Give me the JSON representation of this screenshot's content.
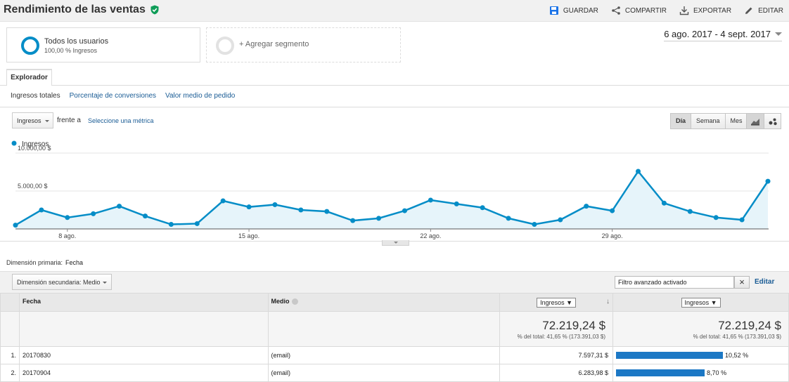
{
  "header": {
    "title": "Rendimiento de las ventas",
    "actions": {
      "save": "GUARDAR",
      "share": "COMPARTIR",
      "export": "EXPORTAR",
      "edit": "EDITAR"
    }
  },
  "segments": {
    "seg1_title": "Todos los usuarios",
    "seg1_sub": "100,00 % Ingresos",
    "seg2_title": "+ Agregar segmento"
  },
  "date_range": "6 ago. 2017 - 4 sept. 2017",
  "tab": "Explorador",
  "metric_tabs": {
    "t1": "Ingresos totales",
    "t2": "Porcentaje de conversiones",
    "t3": "Valor medio de pedido"
  },
  "chart_controls": {
    "metric": "Ingresos",
    "vs": "frente a",
    "pick": "Seleccione una métrica",
    "day": "Día",
    "week": "Semana",
    "month": "Mes"
  },
  "colors": {
    "series": "#058dc7",
    "fill": "#e6f4fa",
    "bar": "#1c78c5",
    "link": "#1a5c95"
  },
  "chart_data": {
    "type": "area",
    "legend": "Ingresos",
    "y_ticks": [
      "10.000,00 $",
      "5.000,00 $"
    ],
    "ylim": [
      0,
      10000
    ],
    "x_ticks": [
      "8 ago.",
      "15 ago.",
      "22 ago.",
      "29 ago."
    ],
    "x_tick_indices": [
      2,
      9,
      16,
      23
    ],
    "values": [
      500,
      2500,
      1500,
      2000,
      3000,
      1700,
      600,
      700,
      3700,
      2900,
      3200,
      2500,
      2300,
      1100,
      1400,
      2400,
      3800,
      3300,
      2800,
      1400,
      600,
      1200,
      3000,
      2400,
      7597,
      3400,
      2300,
      1500,
      1200,
      6284
    ]
  },
  "dimension": {
    "label": "Dimensión primaria:",
    "value": "Fecha",
    "secondary": "Dimensión secundaria: Medio",
    "filter": "Filtro avanzado activado",
    "edit": "Editar"
  },
  "table": {
    "col_date": "Fecha",
    "col_medium": "Medio",
    "col_rev": "Ingresos",
    "col_rev2": "Ingresos",
    "total": "72.219,24 $",
    "total_sub": "% del total: 41,65 % (173.391,03 $)",
    "total2": "72.219,24 $",
    "total2_sub": "% del total: 41,65 % (173.391,03 $)",
    "rows": [
      {
        "n": "1.",
        "date": "20170830",
        "medium": "(email)",
        "rev": "7.597,31 $",
        "pct": "10,52 %",
        "share": 0.1052
      },
      {
        "n": "2.",
        "date": "20170904",
        "medium": "(email)",
        "rev": "6.283,98 $",
        "pct": "8,70 %",
        "share": 0.087
      }
    ]
  }
}
